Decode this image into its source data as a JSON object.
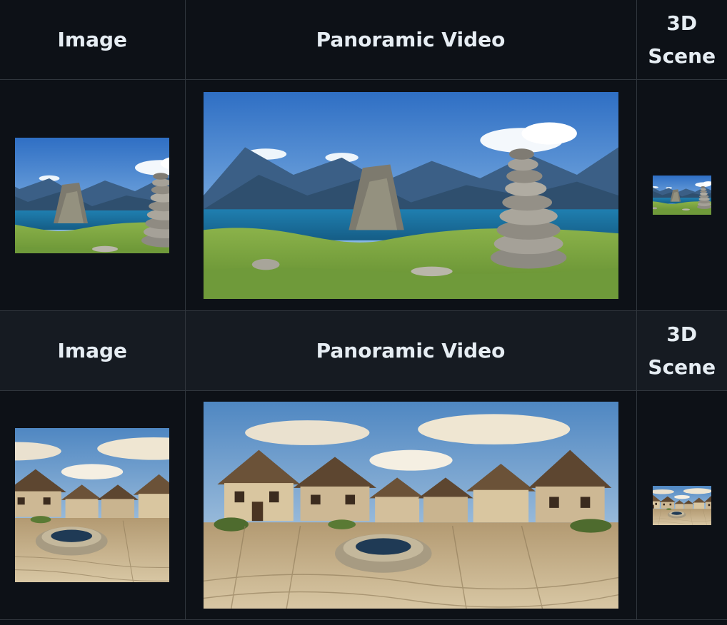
{
  "rows": [
    {
      "headers": {
        "image": "Image",
        "video": "Panoramic Video",
        "scene": "3D Scene"
      },
      "media": {
        "image": "mountain-lake-cairn-photo",
        "video": "mountain-lake-cairn-panorama",
        "scene": "mountain-lake-cairn-3d-thumbnail"
      }
    },
    {
      "headers": {
        "image": "Image",
        "video": "Panoramic Video",
        "scene": "3D Scene"
      },
      "media": {
        "image": "village-well-photo",
        "video": "village-well-panorama",
        "scene": "village-well-3d-thumbnail"
      }
    }
  ]
}
